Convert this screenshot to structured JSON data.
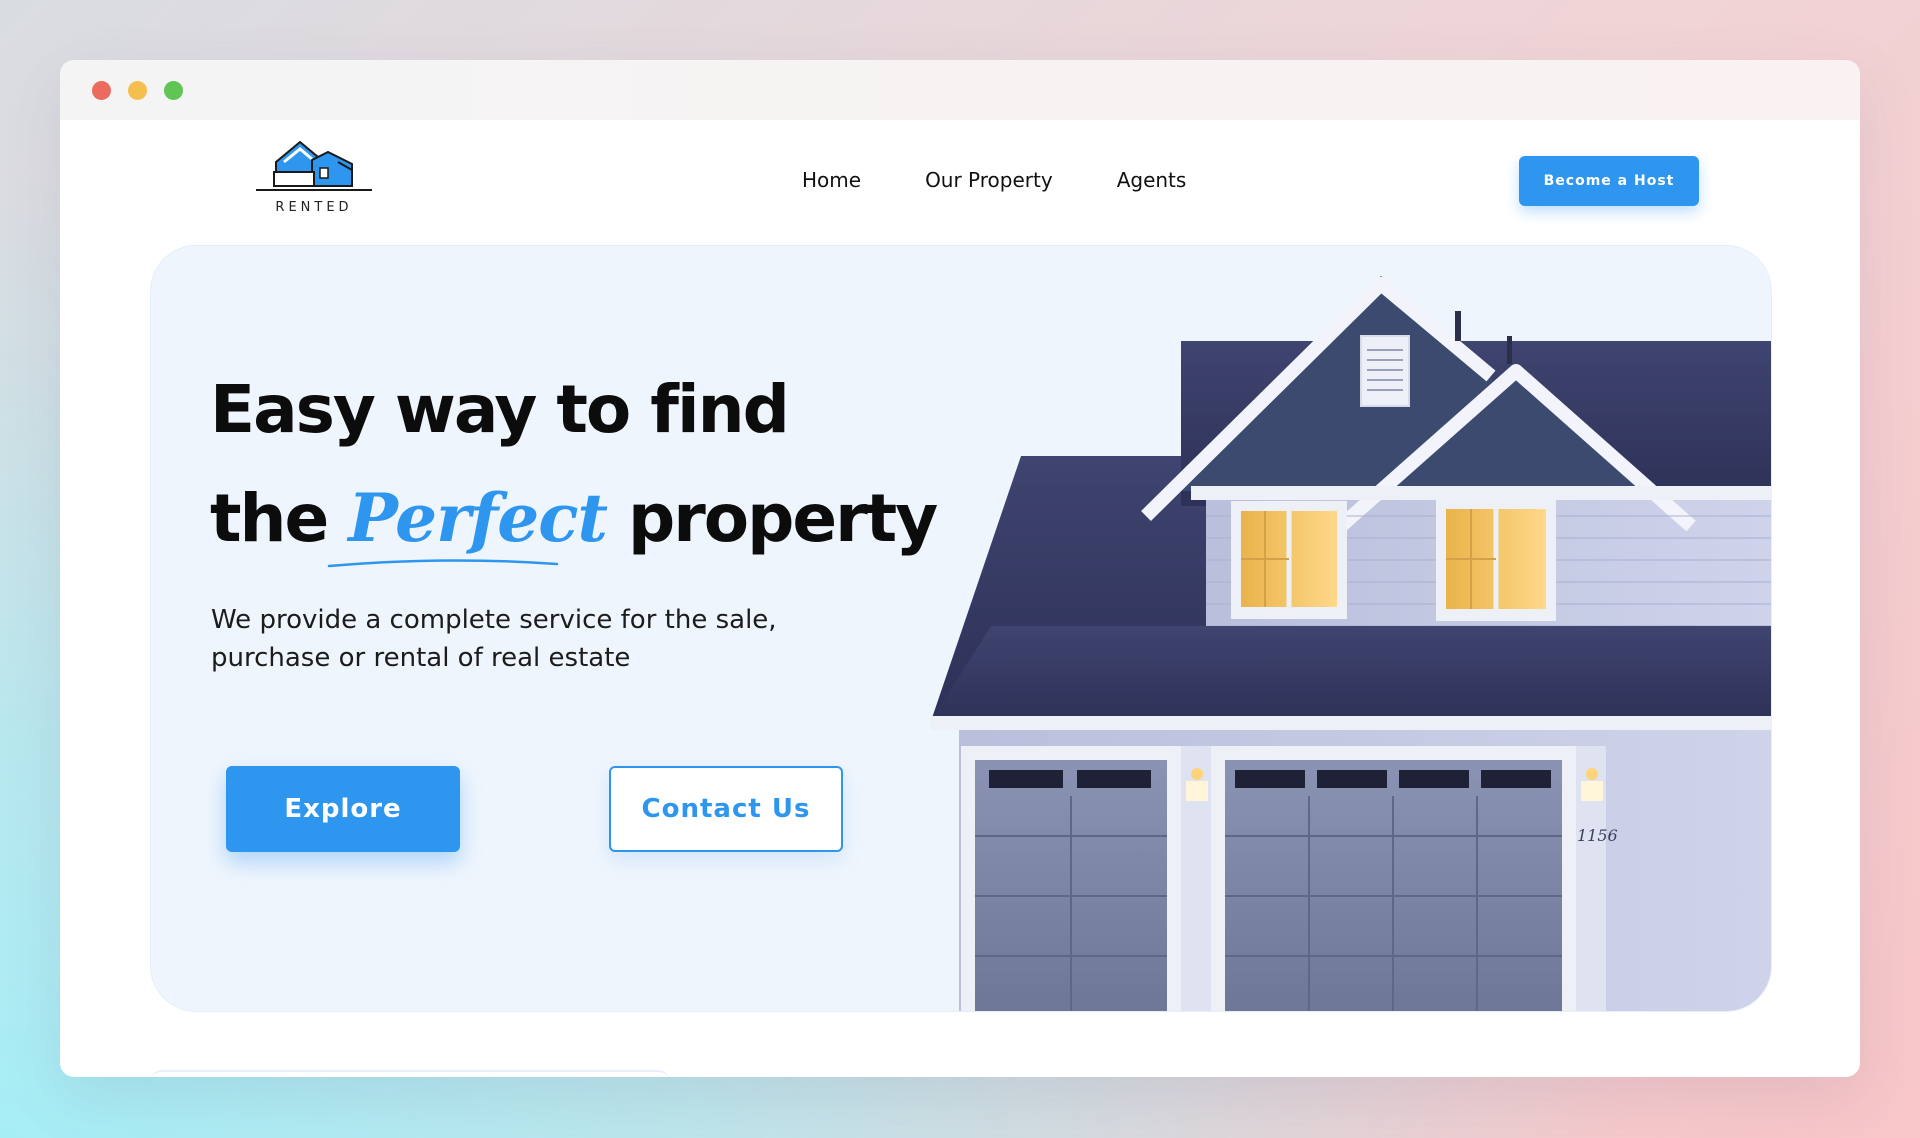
{
  "window": {
    "controls": [
      "close",
      "minimize",
      "maximize"
    ]
  },
  "brand": {
    "name": "RENTED",
    "logo_icon": "house-logo-icon",
    "accent_color": "#2e96ee"
  },
  "nav": {
    "items": [
      {
        "label": "Home"
      },
      {
        "label": "Our Property"
      },
      {
        "label": "Agents"
      }
    ],
    "cta_label": "Become a Host"
  },
  "hero": {
    "headline_line1": "Easy way to find",
    "headline_line2_prefix": "the",
    "headline_highlight": "Perfect",
    "headline_line2_suffix": "property",
    "subtitle": "We provide a complete service for the sale, purchase or rental of real estate",
    "primary_button": "Explore",
    "secondary_button": "Contact Us",
    "house_number": "1156",
    "image_subject": "house-illustration"
  }
}
